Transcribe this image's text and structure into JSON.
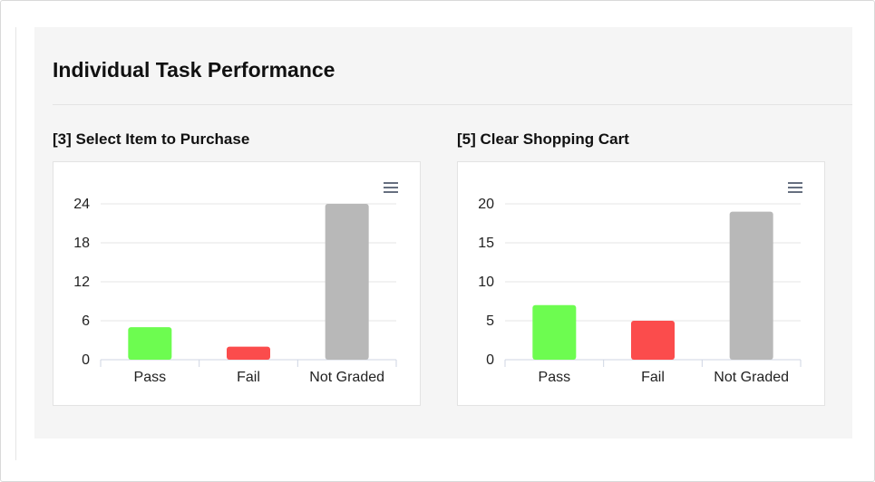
{
  "page": {
    "title": "Individual Task Performance"
  },
  "charts": [
    {
      "title": "[3] Select Item to Purchase",
      "menu_icon": "hamburger-menu-icon"
    },
    {
      "title": "[5] Clear Shopping Cart",
      "menu_icon": "hamburger-menu-icon"
    }
  ],
  "chart_data": [
    {
      "type": "bar",
      "title": "[3] Select Item to Purchase",
      "categories": [
        "Pass",
        "Fail",
        "Not Graded"
      ],
      "values": [
        5,
        2,
        24
      ],
      "colors": [
        "#6dfc50",
        "#fb4c4c",
        "#b8b8b8"
      ],
      "yticks": [
        0,
        6,
        12,
        18,
        24
      ],
      "ylim": [
        0,
        24
      ],
      "grid": true,
      "legend": "none"
    },
    {
      "type": "bar",
      "title": "[5] Clear Shopping Cart",
      "categories": [
        "Pass",
        "Fail",
        "Not Graded"
      ],
      "values": [
        7,
        5,
        19
      ],
      "colors": [
        "#6dfc50",
        "#fb4c4c",
        "#b8b8b8"
      ],
      "yticks": [
        0,
        5,
        10,
        15,
        20
      ],
      "ylim": [
        0,
        20
      ],
      "grid": true,
      "legend": "none"
    }
  ]
}
